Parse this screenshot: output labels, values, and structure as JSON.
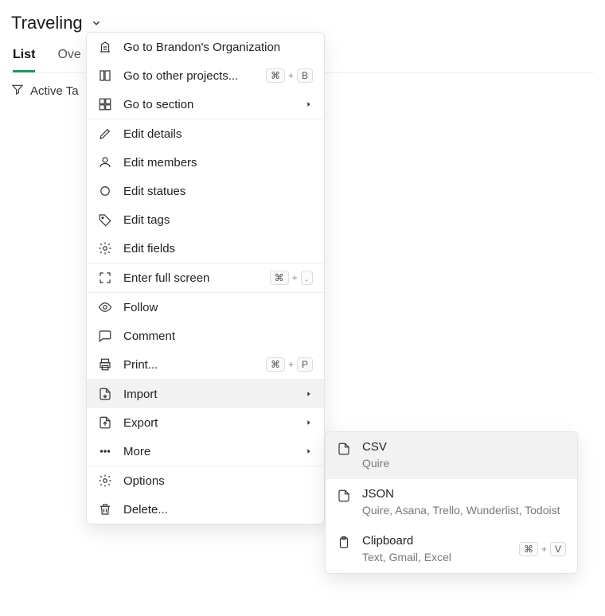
{
  "project": {
    "name": "Traveling"
  },
  "tabs": {
    "list": "List",
    "overview_partial": "Ove"
  },
  "filter": {
    "label": "Active Ta"
  },
  "menu": {
    "go_org": "Go to Brandon's Organization",
    "go_other": "Go to other projects...",
    "go_other_key1": "⌘",
    "go_other_key2": "B",
    "go_section": "Go to section",
    "edit_details": "Edit details",
    "edit_members": "Edit members",
    "edit_statues": "Edit statues",
    "edit_tags": "Edit tags",
    "edit_fields": "Edit fields",
    "full_screen": "Enter full screen",
    "full_screen_key1": "⌘",
    "full_screen_key2": ".",
    "follow": "Follow",
    "comment": "Comment",
    "print": "Print...",
    "print_key1": "⌘",
    "print_key2": "P",
    "import": "Import",
    "export": "Export",
    "more": "More",
    "options": "Options",
    "delete": "Delete..."
  },
  "plus": "+",
  "submenu": {
    "csv": {
      "title": "CSV",
      "sub": "Quire"
    },
    "json": {
      "title": "JSON",
      "sub": "Quire, Asana, Trello, Wunderlist, Todoist"
    },
    "clipboard": {
      "title": "Clipboard",
      "sub": "Text, Gmail, Excel",
      "key1": "⌘",
      "key2": "V"
    }
  }
}
